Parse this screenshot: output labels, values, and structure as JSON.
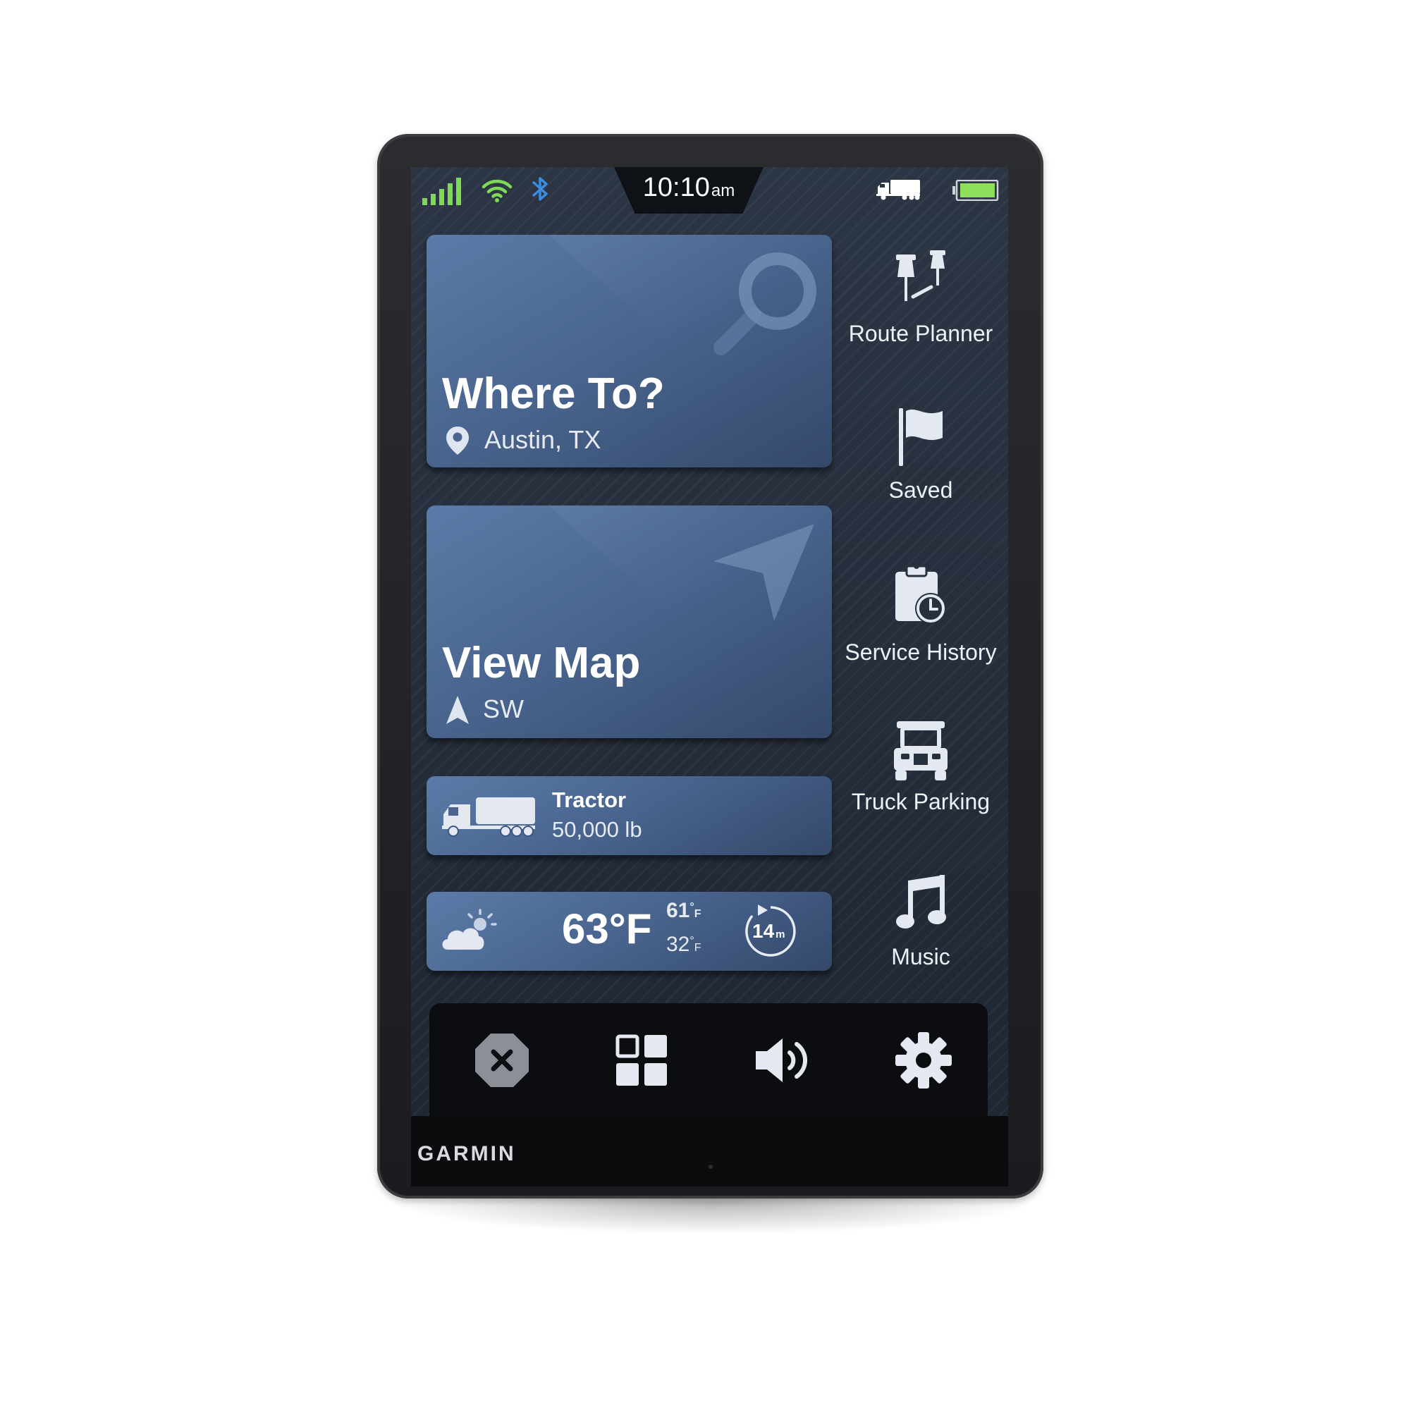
{
  "brand": "GARMIN",
  "status": {
    "time": "10:10",
    "ampm": "am",
    "icons": [
      "signal-icon",
      "wifi-icon",
      "bluetooth-icon",
      "truck-mode-icon",
      "battery-icon"
    ]
  },
  "cards": {
    "where_to": {
      "title": "Where To?",
      "subtitle": "Austin, TX",
      "icon": "search-icon"
    },
    "view_map": {
      "title": "View Map",
      "subtitle": "SW",
      "icon": "navigation-arrow-icon"
    },
    "vehicle": {
      "name": "Tractor",
      "weight": "50,000 lb",
      "icon": "truck-icon"
    },
    "weather": {
      "temp": "63°F",
      "high": "61",
      "low": "32",
      "unit": "F",
      "interval": "14",
      "interval_unit": "m",
      "icon": "partly-cloudy-icon"
    }
  },
  "menu": [
    {
      "label": "Route Planner",
      "icon": "route-planner-icon"
    },
    {
      "label": "Saved",
      "icon": "flag-icon"
    },
    {
      "label": "Service History",
      "icon": "service-history-icon"
    },
    {
      "label": "Truck Parking",
      "icon": "truck-parking-icon"
    },
    {
      "label": "Music",
      "icon": "music-icon"
    }
  ],
  "dock": [
    "close-icon",
    "apps-grid-icon",
    "volume-icon",
    "settings-gear-icon"
  ],
  "colors": {
    "signal": "#7ed957",
    "bluetooth": "#3b8de0",
    "battery": "#8ee05a",
    "card": "#4a6690",
    "screen": "#253040"
  }
}
